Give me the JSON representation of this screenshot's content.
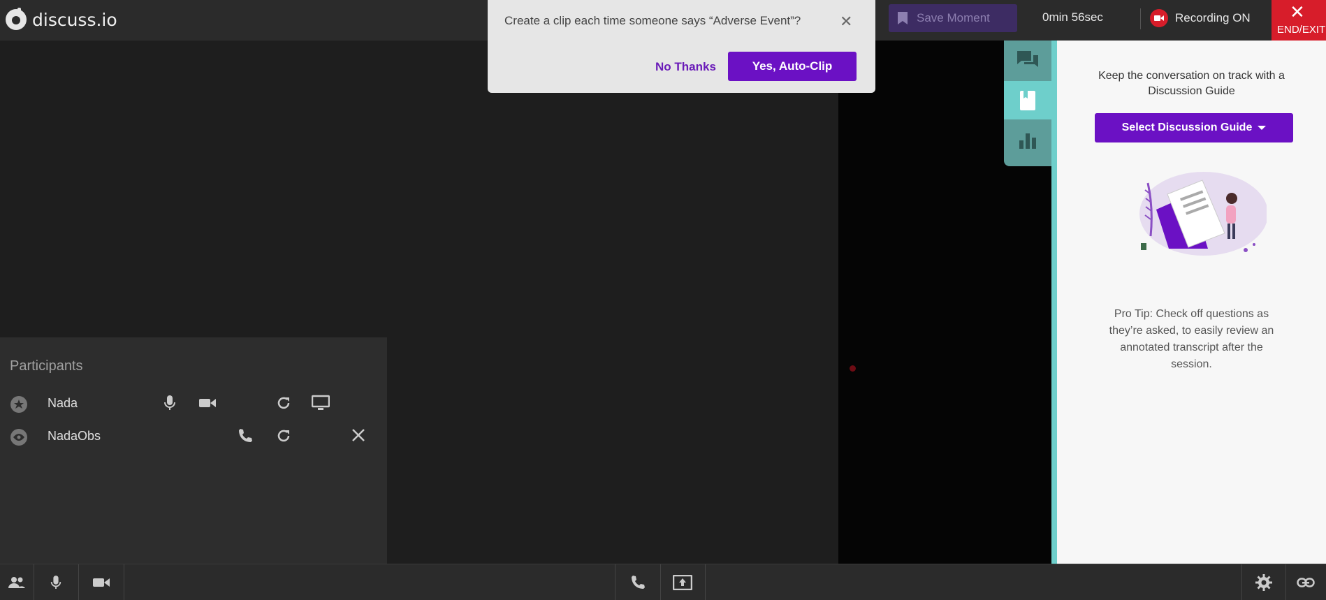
{
  "app": {
    "name": "discuss.io"
  },
  "topbar": {
    "save_moment_label": "Save Moment",
    "timer": "0min 56sec",
    "recording_label": "Recording ON",
    "end_exit_label": "END/EXIT"
  },
  "popup": {
    "question": "Create a clip each time someone says “Adverse Event”?",
    "no_label": "No Thanks",
    "yes_label": "Yes, Auto-Clip"
  },
  "side_tabs": [
    {
      "icon": "chat-icon",
      "active": false
    },
    {
      "icon": "bookmark-icon",
      "active": true
    },
    {
      "icon": "bar-chart-icon",
      "active": false
    }
  ],
  "guide": {
    "title": "Keep the conversation on track with a Discussion Guide",
    "button_label": "Select Discussion Guide",
    "pro_tip": "Pro Tip: Check off questions as they’re asked, to easily review an annotated transcript after the session."
  },
  "participants": {
    "title": "Participants",
    "list": [
      {
        "name": "Nada",
        "role_icon": "star-icon",
        "controls": [
          "mic-icon",
          "video-icon",
          "refresh-icon",
          "screen-icon"
        ]
      },
      {
        "name": "NadaObs",
        "role_icon": "eye-icon",
        "controls": [
          "phone-icon",
          "refresh-icon",
          "close-icon"
        ]
      }
    ]
  },
  "bottombar": {
    "left": [
      "participants-icon",
      "mic-icon",
      "video-icon"
    ],
    "center": [
      "phone-icon",
      "share-screen-icon"
    ],
    "right": [
      "settings-icon",
      "link-icon"
    ]
  },
  "colors": {
    "accent": "#6b11c4",
    "teal": "#6ecfcb",
    "record_red": "#d71d2a"
  }
}
